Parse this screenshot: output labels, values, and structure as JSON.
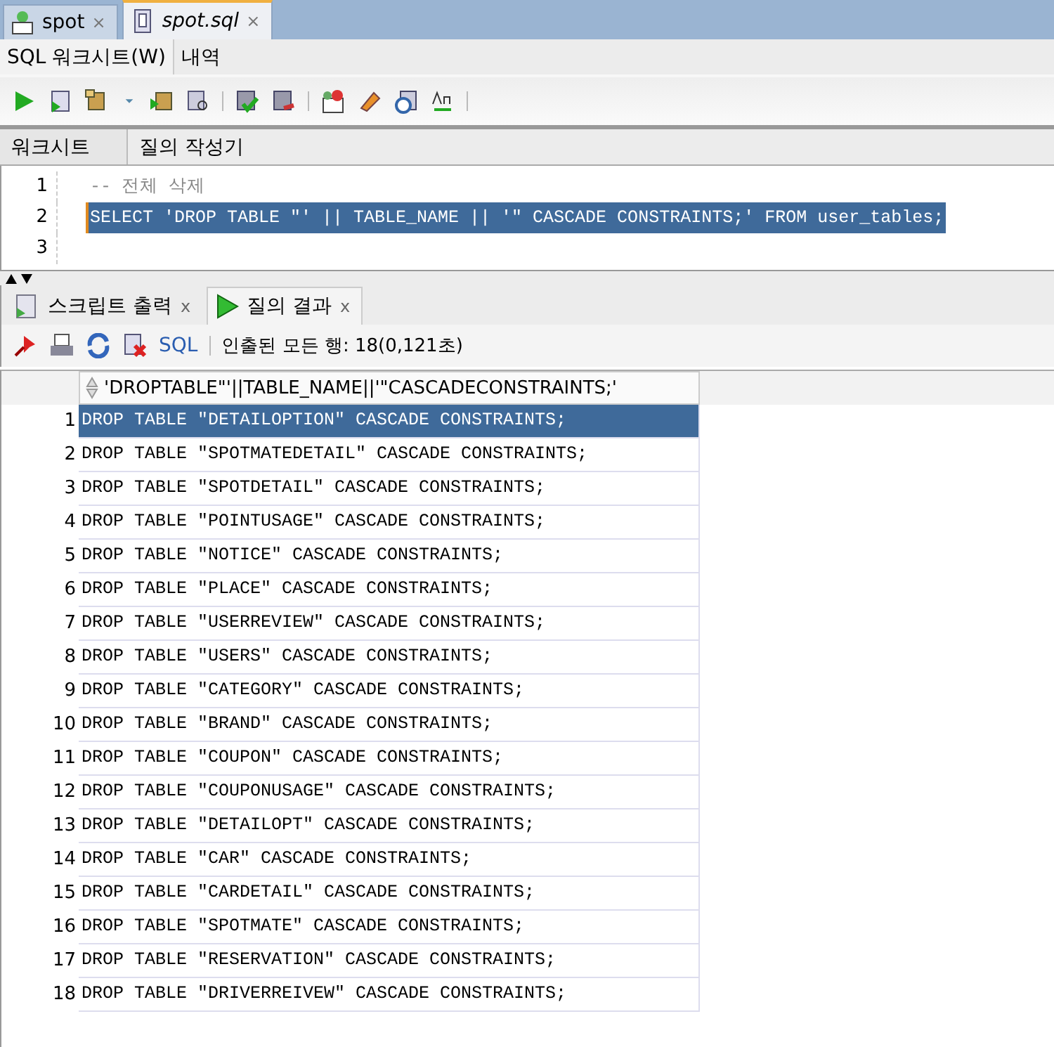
{
  "document_tabs": [
    {
      "label": "spot",
      "kind": "connection",
      "selected": false,
      "close": "×"
    },
    {
      "label": "spot.sql",
      "kind": "file",
      "selected": true,
      "close": "×"
    }
  ],
  "view_tabs": [
    {
      "label": "SQL 워크시트(W)",
      "selected": true
    },
    {
      "label": "내역",
      "selected": false
    }
  ],
  "editor_tabs": [
    {
      "label": "워크시트",
      "selected": true
    },
    {
      "label": "질의 작성기",
      "selected": false
    }
  ],
  "editor_lines": [
    {
      "number": "1",
      "text": "-- 전체 삭제",
      "kind": "comment",
      "selected": false
    },
    {
      "number": "2",
      "text": "SELECT 'DROP TABLE \"' || TABLE_NAME || '\" CASCADE CONSTRAINTS;' FROM user_tables;",
      "kind": "code",
      "selected": true
    },
    {
      "number": "3"
    }
  ],
  "output_tabs": [
    {
      "label": "스크립트 출력",
      "kind": "script",
      "selected": false,
      "close": "x"
    },
    {
      "label": "질의 결과",
      "kind": "query",
      "selected": true,
      "close": "x"
    }
  ],
  "results_toolbar": {
    "sql_link": "SQL",
    "status": "인출된 모든 행: 18(0,121초)"
  },
  "results": {
    "column": "'DROPTABLE\"'||TABLE_NAME||'\"CASCADECONSTRAINTS;'",
    "rows": [
      {
        "number": "1",
        "text": "DROP TABLE \"DETAILOPTION\" CASCADE CONSTRAINTS;",
        "selected": true
      },
      {
        "number": "2",
        "text": "DROP TABLE \"SPOTMATEDETAIL\" CASCADE CONSTRAINTS;",
        "selected": false
      },
      {
        "number": "3",
        "text": "DROP TABLE \"SPOTDETAIL\" CASCADE CONSTRAINTS;",
        "selected": false
      },
      {
        "number": "4",
        "text": "DROP TABLE \"POINTUSAGE\" CASCADE CONSTRAINTS;",
        "selected": false
      },
      {
        "number": "5",
        "text": "DROP TABLE \"NOTICE\" CASCADE CONSTRAINTS;",
        "selected": false
      },
      {
        "number": "6",
        "text": "DROP TABLE \"PLACE\" CASCADE CONSTRAINTS;",
        "selected": false
      },
      {
        "number": "7",
        "text": "DROP TABLE \"USERREVIEW\" CASCADE CONSTRAINTS;",
        "selected": false
      },
      {
        "number": "8",
        "text": "DROP TABLE \"USERS\" CASCADE CONSTRAINTS;",
        "selected": false
      },
      {
        "number": "9",
        "text": "DROP TABLE \"CATEGORY\" CASCADE CONSTRAINTS;",
        "selected": false
      },
      {
        "number": "10",
        "text": "DROP TABLE \"BRAND\" CASCADE CONSTRAINTS;",
        "selected": false
      },
      {
        "number": "11",
        "text": "DROP TABLE \"COUPON\" CASCADE CONSTRAINTS;",
        "selected": false
      },
      {
        "number": "12",
        "text": "DROP TABLE \"COUPONUSAGE\" CASCADE CONSTRAINTS;",
        "selected": false
      },
      {
        "number": "13",
        "text": "DROP TABLE \"DETAILOPT\" CASCADE CONSTRAINTS;",
        "selected": false
      },
      {
        "number": "14",
        "text": "DROP TABLE \"CAR\" CASCADE CONSTRAINTS;",
        "selected": false
      },
      {
        "number": "15",
        "text": "DROP TABLE \"CARDETAIL\" CASCADE CONSTRAINTS;",
        "selected": false
      },
      {
        "number": "16",
        "text": "DROP TABLE \"SPOTMATE\" CASCADE CONSTRAINTS;",
        "selected": false
      },
      {
        "number": "17",
        "text": "DROP TABLE \"RESERVATION\" CASCADE CONSTRAINTS;",
        "selected": false
      },
      {
        "number": "18",
        "text": "DROP TABLE \"DRIVERREIVEW\" CASCADE CONSTRAINTS;",
        "selected": false
      }
    ]
  }
}
